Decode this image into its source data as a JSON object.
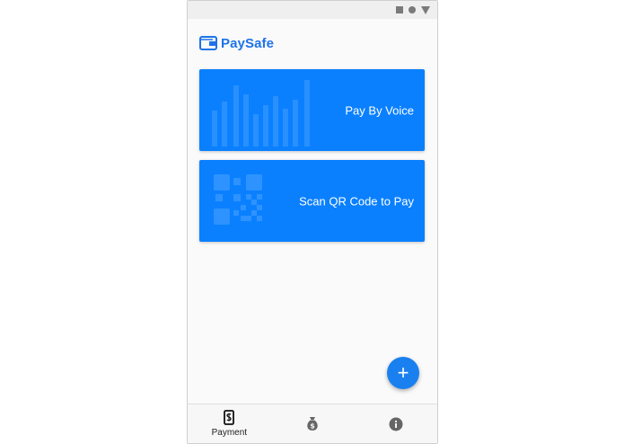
{
  "app": {
    "name": "PaySafe",
    "accent": "#1e73e8"
  },
  "status_bar": {
    "icons": [
      "square-icon",
      "circle-icon",
      "triangle-icon"
    ]
  },
  "cards": [
    {
      "label": "Pay By Voice",
      "icon": "voice-waveform-icon",
      "color": "#0a80ff"
    },
    {
      "label": "Scan QR Code to Pay",
      "icon": "qr-code-icon",
      "color": "#0a80ff"
    }
  ],
  "fab": {
    "symbol": "+",
    "icon": "add-icon"
  },
  "bottom_nav": {
    "items": [
      {
        "label": "Payment",
        "icon": "phone-dollar-icon",
        "active": true
      },
      {
        "label": "",
        "icon": "money-bag-icon",
        "active": false
      },
      {
        "label": "",
        "icon": "info-icon",
        "active": false
      }
    ]
  }
}
